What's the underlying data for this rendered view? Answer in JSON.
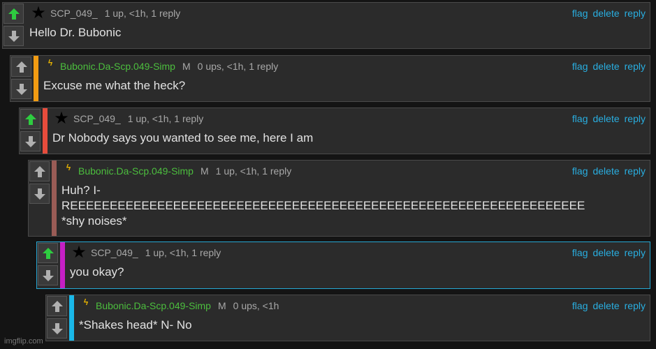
{
  "colors": {
    "upvote_active": "#2ecc40",
    "vote_inactive": "#b0b0b0",
    "link": "#29aee0",
    "username_green": "#4cbe3e",
    "depth_orange": "#f39c12",
    "depth_red": "#e74c3c",
    "depth_brown": "#9a5c56",
    "depth_magenta": "#c51fc5",
    "depth_cyan": "#1ab8e8",
    "highlight_border": "#26a8d4"
  },
  "icons": {
    "upvote": "arrow-up-icon",
    "downvote": "arrow-down-icon",
    "star_badge": "star-icon",
    "bolt_badge": "lightning-icon"
  },
  "actions": {
    "flag": "flag",
    "delete": "delete",
    "reply": "reply"
  },
  "comments": [
    {
      "badge": "★",
      "user": "SCP_049_",
      "mod": "",
      "meta": "1 up, <1h, 1 reply",
      "text": "Hello Dr. Bubonic",
      "upvoted": true,
      "depth_color": ""
    },
    {
      "badge": "ϟ",
      "user": "Bubonic.Da-Scp.049-Simp",
      "mod": "M",
      "meta": "0 ups, <1h, 1 reply",
      "text": "Excuse me what the heck?",
      "upvoted": false,
      "depth_color": "#f39c12"
    },
    {
      "badge": "★",
      "user": "SCP_049_",
      "mod": "",
      "meta": "1 up, <1h, 1 reply",
      "text": "Dr Nobody says you wanted to see me, here I am",
      "upvoted": true,
      "depth_color": "#e74c3c"
    },
    {
      "badge": "ϟ",
      "user": "Bubonic.Da-Scp.049-Simp",
      "mod": "M",
      "meta": "1 up, <1h, 1 reply",
      "text": "Huh? I-\nREEEEEEEEEEEEEEEEEEEEEEEEEEEEEEEEEEEEEEEEEEEEEEEEEEEEEEEEEEEEEEEEE\n*shy noises*",
      "upvoted": false,
      "depth_color": "#9a5c56"
    },
    {
      "badge": "★",
      "user": "SCP_049_",
      "mod": "",
      "meta": "1 up, <1h, 1 reply",
      "text": "you okay?",
      "upvoted": true,
      "depth_color": "#c51fc5"
    },
    {
      "badge": "ϟ",
      "user": "Bubonic.Da-Scp.049-Simp",
      "mod": "M",
      "meta": "0 ups, <1h",
      "text": "*Shakes head* N- No",
      "upvoted": false,
      "depth_color": "#1ab8e8"
    }
  ],
  "watermark": "imgflip.com"
}
